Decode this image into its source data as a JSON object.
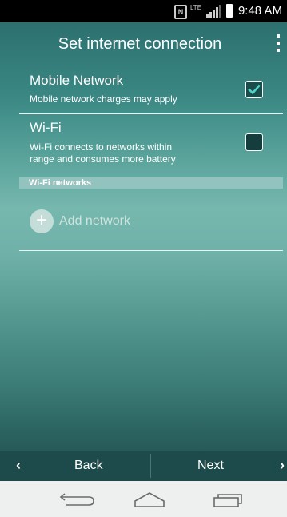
{
  "status_bar": {
    "time": "9:48 AM",
    "nfc_label": "N",
    "network_type": "LTE",
    "icons": [
      "nfc-icon",
      "lte-data-icon",
      "signal-icon",
      "battery-icon"
    ]
  },
  "header": {
    "title": "Set internet connection",
    "menu_icon": "overflow-menu-icon"
  },
  "options": [
    {
      "title": "Mobile Network",
      "subtitle": "Mobile network charges may apply",
      "checked": true
    },
    {
      "title": "Wi-Fi",
      "subtitle_line1": "Wi-Fi connects to networks within",
      "subtitle_line2": "range and consumes more battery",
      "checked": false
    }
  ],
  "wifi_section": {
    "header": "Wi-Fi networks",
    "add_network_label": "Add network"
  },
  "bottom_bar": {
    "back_label": "Back",
    "next_label": "Next",
    "prev_chevron": "‹",
    "next_chevron": "›"
  },
  "nav_bar": {
    "icons": [
      "back-nav-icon",
      "home-nav-icon",
      "recents-nav-icon"
    ]
  },
  "colors": {
    "accent": "#4fd3c8",
    "background_top": "#2b6664",
    "background_mid": "#76b7ae",
    "bottom_bar": "#1d4a4a",
    "nav_bar": "#eef0f0"
  }
}
